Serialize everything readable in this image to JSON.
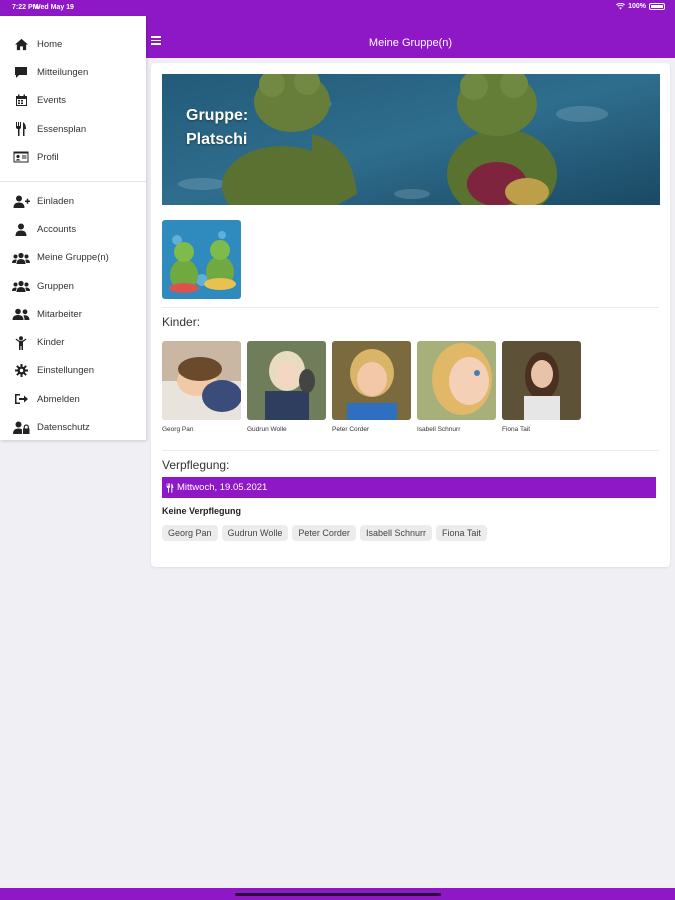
{
  "status": {
    "time": "7:22 PM",
    "date": "Wed May 19",
    "battery": "100%"
  },
  "appbar": {
    "title": "Meine Gruppe(n)"
  },
  "sidebar": {
    "group1": [
      {
        "label": "Home",
        "icon": "home-icon"
      },
      {
        "label": "Mitteilungen",
        "icon": "message-icon"
      },
      {
        "label": "Events",
        "icon": "calendar-icon"
      },
      {
        "label": "Essensplan",
        "icon": "cutlery-icon"
      },
      {
        "label": "Profil",
        "icon": "id-card-icon"
      }
    ],
    "group2": [
      {
        "label": "Einladen",
        "icon": "user-plus-icon"
      },
      {
        "label": "Accounts",
        "icon": "user-icon"
      },
      {
        "label": "Meine Gruppe(n)",
        "icon": "users-icon"
      },
      {
        "label": "Gruppen",
        "icon": "users-icon"
      },
      {
        "label": "Mitarbeiter",
        "icon": "user-friends-icon"
      },
      {
        "label": "Kinder",
        "icon": "child-icon"
      },
      {
        "label": "Einstellungen",
        "icon": "gear-icon"
      },
      {
        "label": "Abmelden",
        "icon": "sign-out-icon"
      },
      {
        "label": "Datenschutz",
        "icon": "user-lock-icon"
      }
    ]
  },
  "group": {
    "title_line1": "Gruppe:",
    "title_line2": "Platschi"
  },
  "kinder": {
    "label": "Kinder:",
    "children": [
      "Georg Pan",
      "Gudrun Wolle",
      "Peter Corder",
      "Isabell Schnurr",
      "Fiona Tait"
    ]
  },
  "verpflegung": {
    "label": "Verpflegung:",
    "day": "Mittwoch, 19.05.2021",
    "none_label": "Keine Verpflegung",
    "chips": [
      "Georg Pan",
      "Gudrun Wolle",
      "Peter Corder",
      "Isabell Schnurr",
      "Fiona Tait"
    ]
  },
  "colors": {
    "brand": "#8e18c6",
    "background": "#efeff4"
  }
}
